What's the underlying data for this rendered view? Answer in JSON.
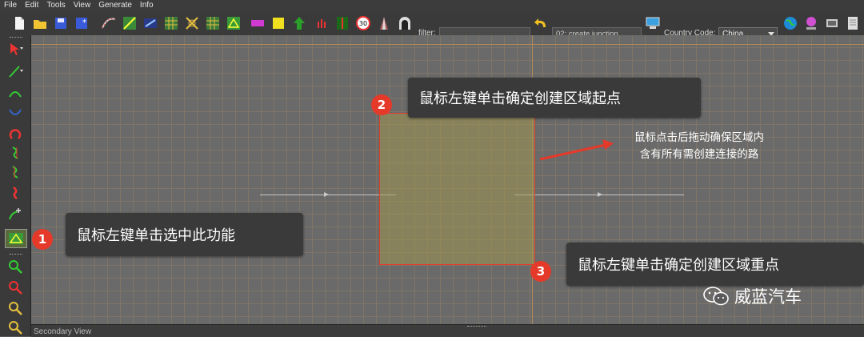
{
  "menu": [
    "File",
    "Edit",
    "Tools",
    "View",
    "Generate",
    "Info"
  ],
  "toolbar": {
    "filter_label": "filter:",
    "filter_value": "",
    "mode_value": "02: create junction",
    "country_label": "Country Code:",
    "country_value": "China",
    "speed_sign_text": "30",
    "tool_icons": [
      "new-file-icon",
      "open-folder-icon",
      "save-icon",
      "save-as-icon",
      "road-curve-icon",
      "road-select-icon",
      "junction-icon",
      "grid-icon",
      "cross-grid-icon",
      "terrain-icon",
      "magenta-bar-icon",
      "yellow-square-icon",
      "green-tree-icon",
      "red-marker-icon",
      "road-lane-icon",
      "speed-sign-icon",
      "cone-icon",
      "tunnel-icon",
      "undo-icon",
      "monitor-icon",
      "earth-icon",
      "fbx-icon",
      "export-icon",
      "panel-icon"
    ]
  },
  "left_toolbar": {
    "icons": [
      "select-arrow-icon",
      "line-tool-icon",
      "arc-up-icon",
      "arc-down-icon",
      "loop-icon",
      "curve-s-icon",
      "curve-s2-icon",
      "curve-red-icon",
      "add-road-icon",
      "create-junction-icon",
      "zoom-in-icon",
      "zoom-out-icon",
      "zoom-fit-icon",
      "zoom-all-icon"
    ]
  },
  "annotations": {
    "step1": {
      "badge": "1",
      "text": "鼠标左键单击选中此功能"
    },
    "step2": {
      "badge": "2",
      "text": "鼠标左键单击确定创建区域起点"
    },
    "step3": {
      "badge": "3",
      "text": "鼠标左键单击确定创建区域重点"
    },
    "note_line1": "鼠标点击后拖动确保区域内",
    "note_line2": "含有所有需创建连接的路"
  },
  "watermark": "威蓝汽车",
  "secondary_view_title": "Secondary View",
  "colors": {
    "accent_red": "#e53a2a",
    "selection_fill": "#a09650",
    "tooltip_bg": "#3a3a3a"
  }
}
